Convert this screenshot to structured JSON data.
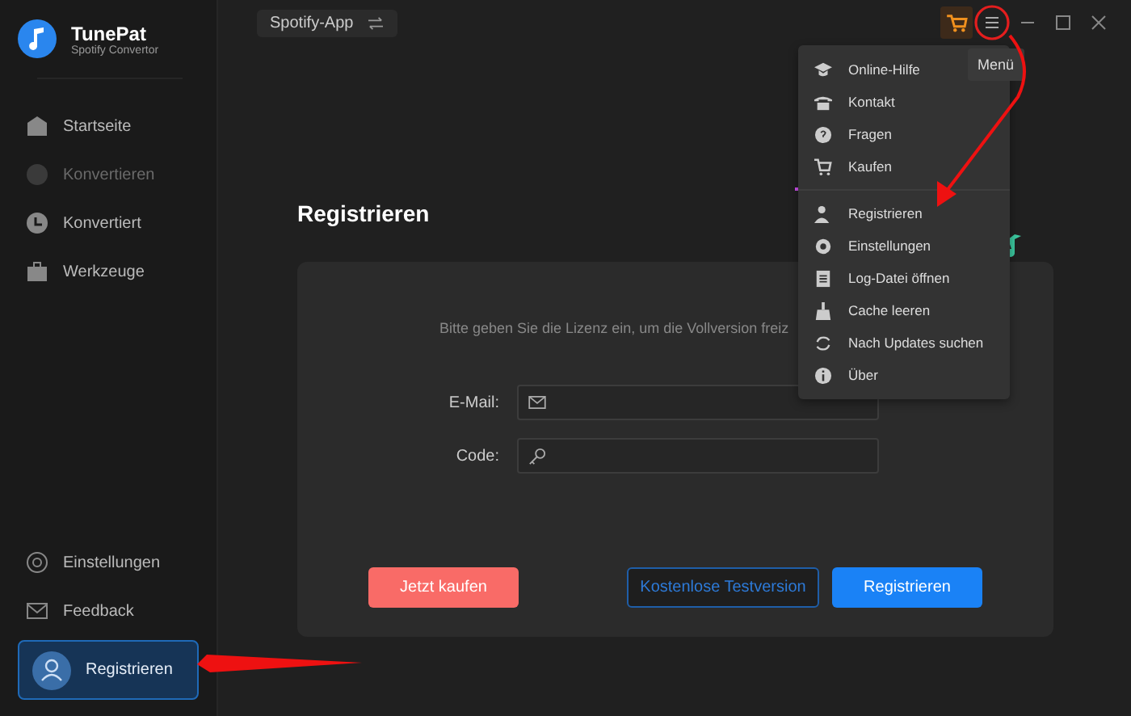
{
  "app": {
    "name": "TunePat",
    "subtitle": "Spotify Convertor"
  },
  "nav": [
    {
      "label": "Startseite",
      "disabled": false
    },
    {
      "label": "Konvertieren",
      "disabled": true
    },
    {
      "label": "Konvertiert",
      "disabled": false
    },
    {
      "label": "Werkzeuge",
      "disabled": false
    }
  ],
  "nav_bottom": [
    "Einstellungen",
    "Feedback"
  ],
  "register_button": "Registrieren",
  "source_chip": "Spotify-App",
  "page_title": "Registrieren",
  "prompt": "Bitte geben Sie die Lizenz ein, um die Vollversion freiz",
  "fields": [
    "E-Mail:",
    "Code:"
  ],
  "buttons": [
    {
      "label": "Jetzt kaufen",
      "kind": "buy"
    },
    {
      "label": "Kostenlose Testversion",
      "kind": "trial"
    },
    {
      "label": "Registrieren",
      "kind": "primary"
    }
  ],
  "tooltip": "Menü",
  "menu_sections": [
    [
      "Online-Hilfe",
      "Kontakt",
      "Fragen",
      "Kaufen"
    ],
    [
      "Registrieren",
      "Einstellungen",
      "Log-Datei öffnen",
      "Cache leeren",
      "Nach Updates suchen",
      "Über"
    ]
  ]
}
